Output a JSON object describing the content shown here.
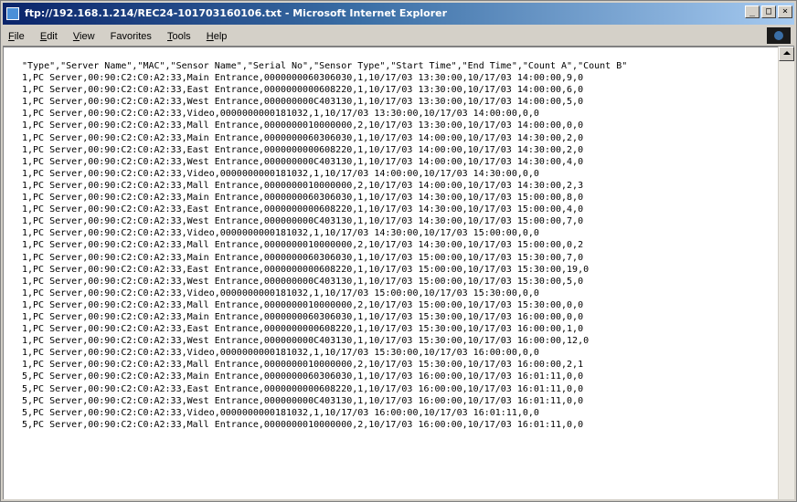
{
  "window": {
    "title": "ftp://192.168.1.214/REC24-101703160106.txt - Microsoft Internet Explorer",
    "minimize_glyph": "_",
    "maximize_glyph": "□",
    "close_glyph": "×"
  },
  "menu": {
    "items": [
      {
        "first": "F",
        "rest": "ile"
      },
      {
        "first": "E",
        "rest": "dit"
      },
      {
        "first": "V",
        "rest": "iew"
      },
      {
        "first": "Fa",
        "rest": "vorites"
      },
      {
        "first": "T",
        "rest": "ools"
      },
      {
        "first": "H",
        "rest": "elp"
      }
    ]
  },
  "icons": {
    "title": "ie-page-icon",
    "logo": "ie-logo-icon"
  },
  "colors": {
    "title_start": "#0a246a",
    "title_end": "#a6caf0",
    "chrome": "#d4d0c8"
  },
  "document": {
    "lines": [
      "\"Type\",\"Server Name\",\"MAC\",\"Sensor Name\",\"Serial No\",\"Sensor Type\",\"Start Time\",\"End Time\",\"Count A\",\"Count B\"",
      "1,PC Server,00:90:C2:C0:A2:33,Main Entrance,0000000060306030,1,10/17/03 13:30:00,10/17/03 14:00:00,9,0",
      "1,PC Server,00:90:C2:C0:A2:33,East Entrance,0000000000608220,1,10/17/03 13:30:00,10/17/03 14:00:00,6,0",
      "1,PC Server,00:90:C2:C0:A2:33,West Entrance,000000000C403130,1,10/17/03 13:30:00,10/17/03 14:00:00,5,0",
      "1,PC Server,00:90:C2:C0:A2:33,Video,0000000000181032,1,10/17/03 13:30:00,10/17/03 14:00:00,0,0",
      "1,PC Server,00:90:C2:C0:A2:33,Mall Entrance,0000000010000000,2,10/17/03 13:30:00,10/17/03 14:00:00,0,0",
      "1,PC Server,00:90:C2:C0:A2:33,Main Entrance,0000000060306030,1,10/17/03 14:00:00,10/17/03 14:30:00,2,0",
      "1,PC Server,00:90:C2:C0:A2:33,East Entrance,0000000000608220,1,10/17/03 14:00:00,10/17/03 14:30:00,2,0",
      "1,PC Server,00:90:C2:C0:A2:33,West Entrance,000000000C403130,1,10/17/03 14:00:00,10/17/03 14:30:00,4,0",
      "1,PC Server,00:90:C2:C0:A2:33,Video,0000000000181032,1,10/17/03 14:00:00,10/17/03 14:30:00,0,0",
      "1,PC Server,00:90:C2:C0:A2:33,Mall Entrance,0000000010000000,2,10/17/03 14:00:00,10/17/03 14:30:00,2,3",
      "1,PC Server,00:90:C2:C0:A2:33,Main Entrance,0000000060306030,1,10/17/03 14:30:00,10/17/03 15:00:00,8,0",
      "1,PC Server,00:90:C2:C0:A2:33,East Entrance,0000000000608220,1,10/17/03 14:30:00,10/17/03 15:00:00,4,0",
      "1,PC Server,00:90:C2:C0:A2:33,West Entrance,000000000C403130,1,10/17/03 14:30:00,10/17/03 15:00:00,7,0",
      "1,PC Server,00:90:C2:C0:A2:33,Video,0000000000181032,1,10/17/03 14:30:00,10/17/03 15:00:00,0,0",
      "1,PC Server,00:90:C2:C0:A2:33,Mall Entrance,0000000010000000,2,10/17/03 14:30:00,10/17/03 15:00:00,0,2",
      "1,PC Server,00:90:C2:C0:A2:33,Main Entrance,0000000060306030,1,10/17/03 15:00:00,10/17/03 15:30:00,7,0",
      "1,PC Server,00:90:C2:C0:A2:33,East Entrance,0000000000608220,1,10/17/03 15:00:00,10/17/03 15:30:00,19,0",
      "1,PC Server,00:90:C2:C0:A2:33,West Entrance,000000000C403130,1,10/17/03 15:00:00,10/17/03 15:30:00,5,0",
      "1,PC Server,00:90:C2:C0:A2:33,Video,0000000000181032,1,10/17/03 15:00:00,10/17/03 15:30:00,0,0",
      "1,PC Server,00:90:C2:C0:A2:33,Mall Entrance,0000000010000000,2,10/17/03 15:00:00,10/17/03 15:30:00,0,0",
      "1,PC Server,00:90:C2:C0:A2:33,Main Entrance,0000000060306030,1,10/17/03 15:30:00,10/17/03 16:00:00,0,0",
      "1,PC Server,00:90:C2:C0:A2:33,East Entrance,0000000000608220,1,10/17/03 15:30:00,10/17/03 16:00:00,1,0",
      "1,PC Server,00:90:C2:C0:A2:33,West Entrance,000000000C403130,1,10/17/03 15:30:00,10/17/03 16:00:00,12,0",
      "1,PC Server,00:90:C2:C0:A2:33,Video,0000000000181032,1,10/17/03 15:30:00,10/17/03 16:00:00,0,0",
      "1,PC Server,00:90:C2:C0:A2:33,Mall Entrance,0000000010000000,2,10/17/03 15:30:00,10/17/03 16:00:00,2,1",
      "5,PC Server,00:90:C2:C0:A2:33,Main Entrance,0000000060306030,1,10/17/03 16:00:00,10/17/03 16:01:11,0,0",
      "5,PC Server,00:90:C2:C0:A2:33,East Entrance,0000000000608220,1,10/17/03 16:00:00,10/17/03 16:01:11,0,0",
      "5,PC Server,00:90:C2:C0:A2:33,West Entrance,000000000C403130,1,10/17/03 16:00:00,10/17/03 16:01:11,0,0",
      "5,PC Server,00:90:C2:C0:A2:33,Video,0000000000181032,1,10/17/03 16:00:00,10/17/03 16:01:11,0,0",
      "5,PC Server,00:90:C2:C0:A2:33,Mall Entrance,0000000010000000,2,10/17/03 16:00:00,10/17/03 16:01:11,0,0"
    ]
  }
}
